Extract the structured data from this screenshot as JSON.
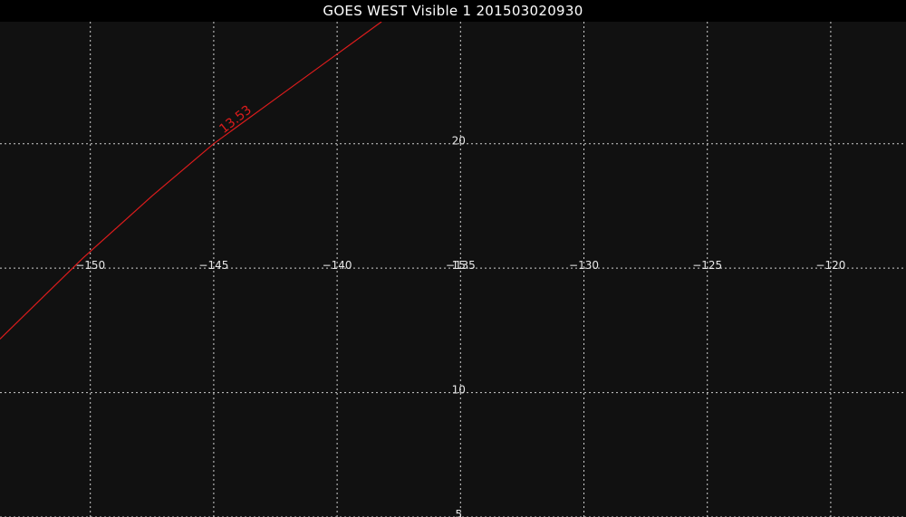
{
  "window": {
    "title": "GOES WEST Visible 1 201503020930"
  },
  "colors": {
    "background": "#000000",
    "image_area": "#111111",
    "grid": "#cfcfcf",
    "labels": "#e8e8e8",
    "contour": "#dd1c1c"
  },
  "map": {
    "longitude_range": [
      -153.66,
      -116.95
    ],
    "latitude_range": [
      5.0,
      24.9
    ],
    "longitude_gridlines": [
      {
        "value": -150,
        "label": "−150"
      },
      {
        "value": -145,
        "label": "−145"
      },
      {
        "value": -140,
        "label": "−140"
      },
      {
        "value": -135,
        "label": "−135"
      },
      {
        "value": -130,
        "label": "−130"
      },
      {
        "value": -125,
        "label": "−125"
      },
      {
        "value": -120,
        "label": "−120"
      }
    ],
    "latitude_gridlines": [
      {
        "value": 20,
        "label": "20"
      },
      {
        "value": 15,
        "label": "15"
      },
      {
        "value": 10,
        "label": "10"
      },
      {
        "value": 5,
        "label": "5"
      }
    ],
    "contour": {
      "label": "13.53",
      "points": [
        [
          -153.66,
          12.15
        ],
        [
          -150.3,
          15.4
        ],
        [
          -147.5,
          17.9
        ],
        [
          -145.0,
          20.0
        ],
        [
          -142.5,
          21.8
        ],
        [
          -140.0,
          23.6
        ],
        [
          -138.2,
          24.9
        ]
      ],
      "label_at": [
        -144.6,
        20.4
      ]
    }
  }
}
